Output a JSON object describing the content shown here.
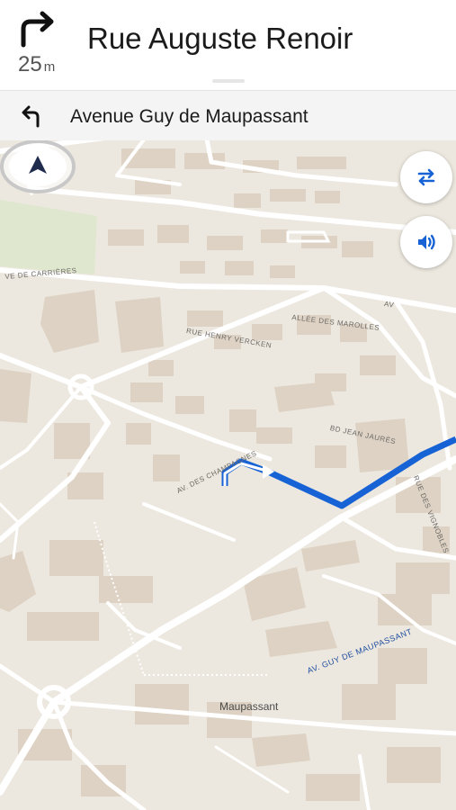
{
  "instruction": {
    "maneuver_icon": "turn-right-icon",
    "distance_value": "25",
    "distance_unit": "m",
    "street": "Rue Auguste Renoir"
  },
  "next_instruction": {
    "maneuver_icon": "turn-left-icon",
    "street": "Avenue Guy de Maupassant"
  },
  "map": {
    "street_labels": {
      "carrieres": "VE DE CARRIÈRES",
      "marolles": "ALLÉE DES MAROLLES",
      "vercken": "RUE HENRY VERCKEN",
      "av": "AV",
      "jaures": "BD JEAN JAURÈS",
      "champagnes": "AV. DES CHAMPAGNES",
      "vignobles": "RUE DES VIGNOBLES",
      "maupassant": "AV. GUY DE MAUPASSANT"
    },
    "place_label": "Maupassant",
    "buttons": {
      "route_options": "route-options-icon",
      "sound": "speaker-icon"
    },
    "colors": {
      "route": "#1763d6",
      "background": "#ece8df",
      "buildings": "#ddd2c3",
      "park": "#dfe8cf",
      "roads": "#ffffff"
    }
  }
}
